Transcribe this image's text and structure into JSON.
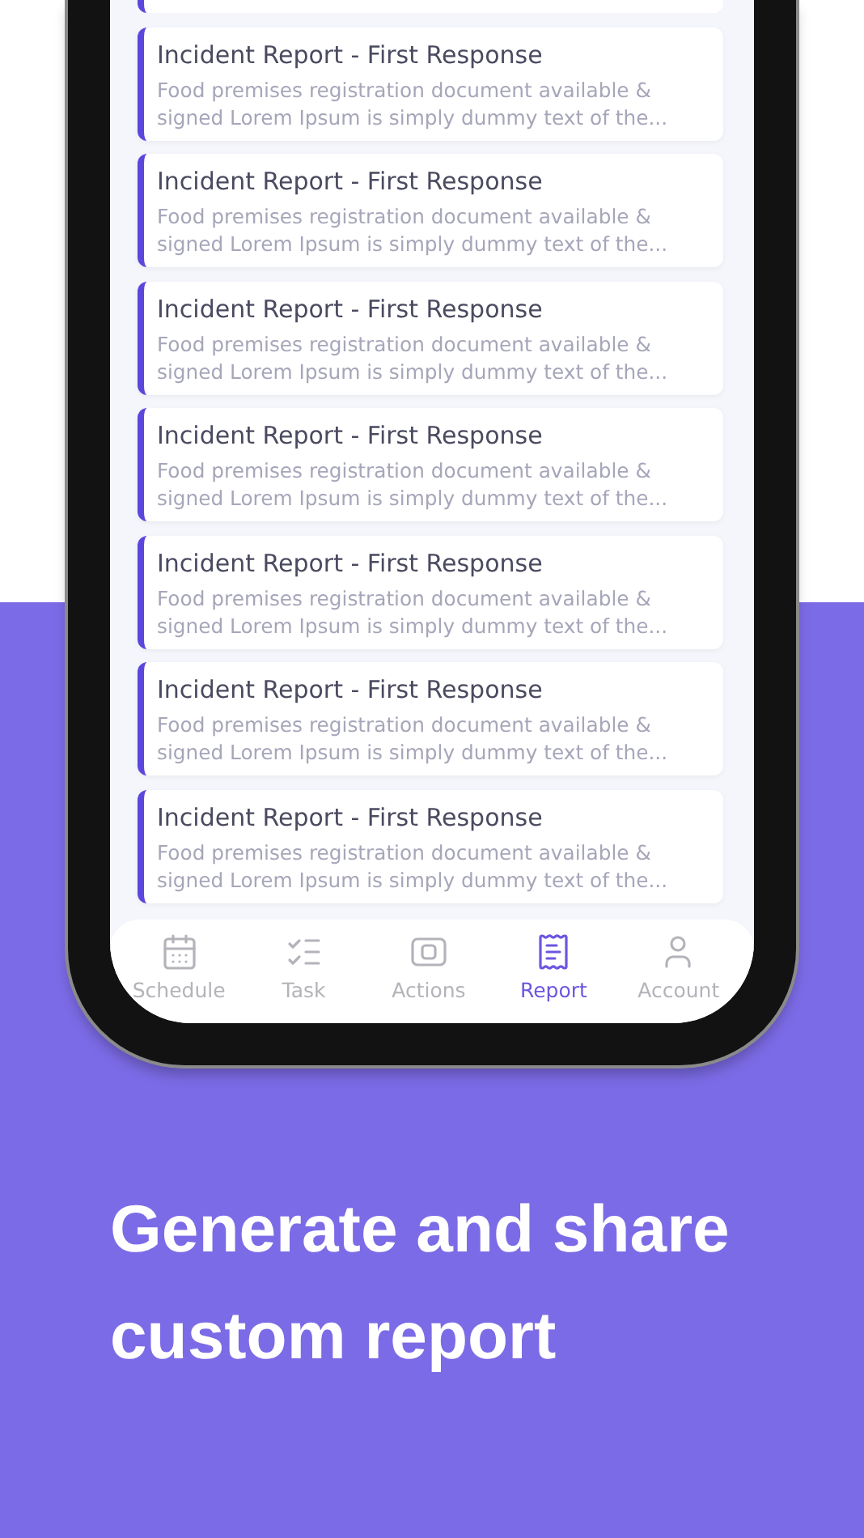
{
  "cards": [
    {
      "title": "Incident Report - First Response",
      "description": "Food premises registration document available & signed Lorem Ipsum is simply dummy text of the..."
    },
    {
      "title": "Incident Report - First Response",
      "description": "Food premises registration document available & signed Lorem Ipsum is simply dummy text of the..."
    },
    {
      "title": "Incident Report - First Response",
      "description": "Food premises registration document available & signed Lorem Ipsum is simply dummy text of the..."
    },
    {
      "title": "Incident Report - First Response",
      "description": "Food premises registration document available & signed Lorem Ipsum is simply dummy text of the..."
    },
    {
      "title": "Incident Report - First Response",
      "description": "Food premises registration document available & signed Lorem Ipsum is simply dummy text of the..."
    },
    {
      "title": "Incident Report - First Response",
      "description": "Food premises registration document available & signed Lorem Ipsum is simply dummy text of the..."
    },
    {
      "title": "Incident Report - First Response",
      "description": "Food premises registration document available & signed Lorem Ipsum is simply dummy text of the..."
    }
  ],
  "nav": [
    {
      "kind": "calendar",
      "label": "Schedule",
      "selected": false
    },
    {
      "kind": "checklist",
      "label": "Task",
      "selected": false
    },
    {
      "kind": "square",
      "label": "Actions",
      "selected": false
    },
    {
      "kind": "receipt",
      "label": "Report",
      "selected": true
    },
    {
      "kind": "person",
      "label": "Account",
      "selected": false
    }
  ],
  "tagline": "Generate and share custom report"
}
